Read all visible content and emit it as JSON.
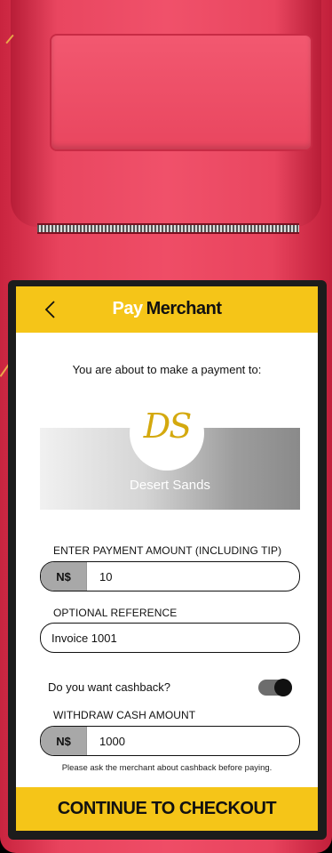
{
  "header": {
    "title_pay": "Pay",
    "title_merchant": "Merchant"
  },
  "intro_text": "You are about to make a payment to:",
  "merchant": {
    "logo_text": "DS",
    "name": "Desert Sands"
  },
  "payment_amount": {
    "label": "ENTER PAYMENT AMOUNT (INCLUDING TIP)",
    "currency": "N$",
    "value": "10"
  },
  "reference": {
    "label": "OPTIONAL REFERENCE",
    "value": "Invoice 1001"
  },
  "cashback": {
    "question": "Do you want cashback?",
    "enabled": true
  },
  "withdraw": {
    "label": "WITHDRAW CASH AMOUNT",
    "currency": "N$",
    "value": "1000"
  },
  "note": "Please ask the merchant about cashback before paying.",
  "cta_label": "CONTINUE TO CHECKOUT",
  "colors": {
    "accent": "#f5c518",
    "device": "#ef4d66"
  }
}
